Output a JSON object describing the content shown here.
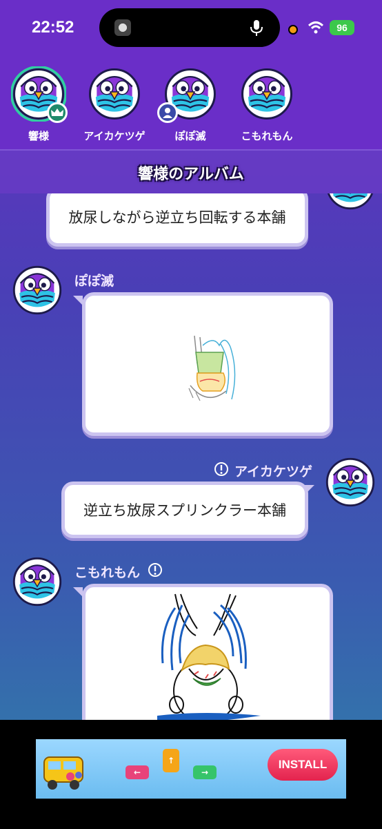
{
  "status_bar": {
    "time": "22:52",
    "battery": "96"
  },
  "players": [
    {
      "name": "響様",
      "badge": "crown-icon"
    },
    {
      "name": "アイカケツゲ",
      "badge": null
    },
    {
      "name": "ぽぽ滅",
      "badge": "person-icon"
    },
    {
      "name": "こもれもん",
      "badge": null
    }
  ],
  "album": {
    "title": "響様のアルバム"
  },
  "messages": [
    {
      "type": "text",
      "sender": "",
      "text": "放尿しながら逆立ち回転する本舗",
      "side": "right"
    },
    {
      "type": "drawing",
      "sender": "ぽぽ滅",
      "side": "left"
    },
    {
      "type": "text",
      "sender": "アイカケツゲ",
      "text": "逆立ち放尿スプリンクラー本舗",
      "side": "right"
    },
    {
      "type": "drawing",
      "sender": "こもれもん",
      "side": "left"
    }
  ],
  "ad": {
    "install_label": "INSTALL"
  },
  "colors": {
    "header": "#6a2ec8",
    "accent_green": "#2fd0a0",
    "bubble_border": "#ccc4f0"
  }
}
